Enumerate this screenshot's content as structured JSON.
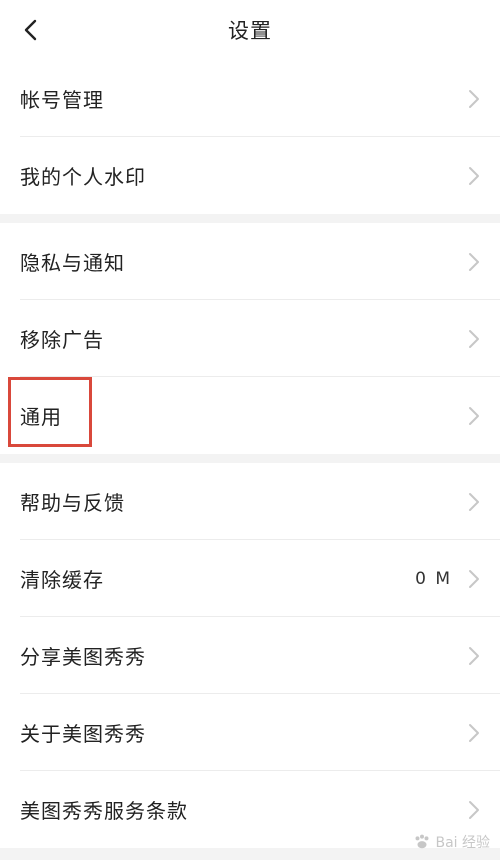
{
  "header": {
    "title": "设置"
  },
  "groups": [
    {
      "items": [
        {
          "label": "帐号管理"
        },
        {
          "label": "我的个人水印"
        }
      ]
    },
    {
      "items": [
        {
          "label": "隐私与通知"
        },
        {
          "label": "移除广告"
        },
        {
          "label": "通用"
        }
      ]
    },
    {
      "items": [
        {
          "label": "帮助与反馈"
        },
        {
          "label": "清除缓存",
          "value": "0 M"
        },
        {
          "label": "分享美图秀秀"
        },
        {
          "label": "关于美图秀秀"
        },
        {
          "label": "美图秀秀服务条款"
        }
      ]
    }
  ],
  "colors": {
    "highlight": "#d9483b",
    "separator": "#f3f3f3",
    "text": "#222222"
  },
  "watermark": {
    "text": "Bai 经验"
  }
}
